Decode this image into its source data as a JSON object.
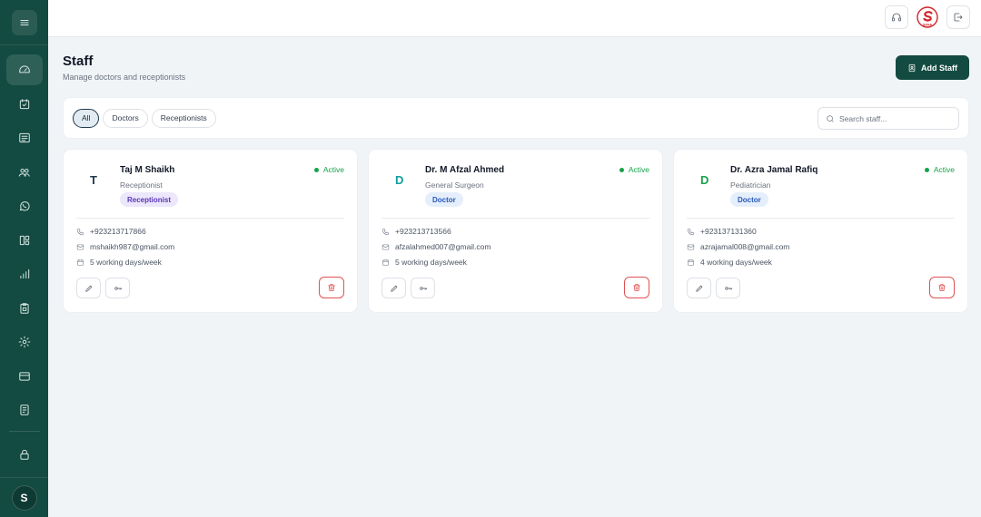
{
  "page": {
    "title": "Staff",
    "subtitle": "Manage doctors and receptionists",
    "add_button_label": "Add Staff"
  },
  "filters": {
    "chips": [
      "All",
      "Doctors",
      "Receptionists"
    ],
    "selected": "All",
    "search_placeholder": "Search staff..."
  },
  "brand": {
    "logo_text": "SANA"
  },
  "sidebar": {
    "active_item": "dashboard",
    "user_initial": "S",
    "items": [
      "dashboard-icon",
      "calendar-icon",
      "file-icon",
      "users-icon",
      "whatsapp-icon",
      "layout-icon",
      "bar-chart-icon",
      "clipboard-icon",
      "settings-icon",
      "credit-card-icon",
      "document-icon",
      "lock-icon"
    ]
  },
  "topbar": {
    "icons": [
      "headset-icon",
      "brand-logo",
      "logout-icon"
    ]
  },
  "staff": [
    {
      "initial": "T",
      "initial_color": "#1e3a4c",
      "name": "Taj M Shaikh",
      "role": "Receptionist",
      "badge": "Receptionist",
      "badge_type": "receptionist",
      "status": "Active",
      "phone": "+923213717866",
      "email": "mshaikh987@gmail.com",
      "schedule": "5 working days/week"
    },
    {
      "initial": "D",
      "initial_color": "#0f9f9f",
      "name": "Dr. M Afzal Ahmed",
      "role": "General Surgeon",
      "badge": "Doctor",
      "badge_type": "doctor",
      "status": "Active",
      "phone": "+923213713566",
      "email": "afzalahmed007@gmail.com",
      "schedule": "5 working days/week"
    },
    {
      "initial": "D",
      "initial_color": "#16a34a",
      "name": "Dr. Azra Jamal Rafiq",
      "role": "Pediatrician",
      "badge": "Doctor",
      "badge_type": "doctor",
      "status": "Active",
      "phone": "+923137131360",
      "email": "azrajamal008@gmail.com",
      "schedule": "4 working days/week"
    }
  ],
  "colors": {
    "sidebar_bg": "#134a41",
    "primary": "#134a41",
    "active_status": "#16a34a",
    "danger": "#dc2626"
  }
}
